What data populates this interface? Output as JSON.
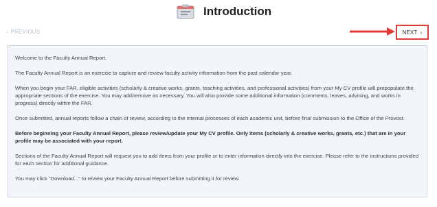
{
  "header": {
    "title": "Introduction",
    "icon": "report-icon"
  },
  "nav": {
    "previous_label": "PREVIOUS",
    "next_label": "NEXT",
    "highlight_color": "#e03a3a"
  },
  "intro": {
    "paragraphs": [
      "Welcome to the Faculty Annual Report.",
      "The Faculty Annual Report is an exercise to capture and review faculty activity information from the past calendar year.",
      "When you begin your FAR, eligible activities (scholarly & creative works, grants, teaching activities, and professional activities) from your My CV profile will prepopulate the appropriate sections of the exercise. You may add/remove as necessary. You will also provide some additional information (comments, leaves, advising, and works in progress) directly within the FAR.",
      "Once submitted, annual reports  follow a chain of review, according to the internal processes of each academic unit, before final submission to the Office of the Provost.",
      "Before beginning your Faculty Annual Report, please review/update your My CV profile. Only items (scholarly & creative works, grants, etc.) that are in your profile may be associated with your report.",
      "Sections of the Faculty Annual Report will request you to add items from your profile or to enter information directly into the exercise. Please refer to the instructions provided for each section for additional guidance.",
      "You may click \"Download...\" to review your Faculty Annual Report before submitting it for review."
    ]
  }
}
